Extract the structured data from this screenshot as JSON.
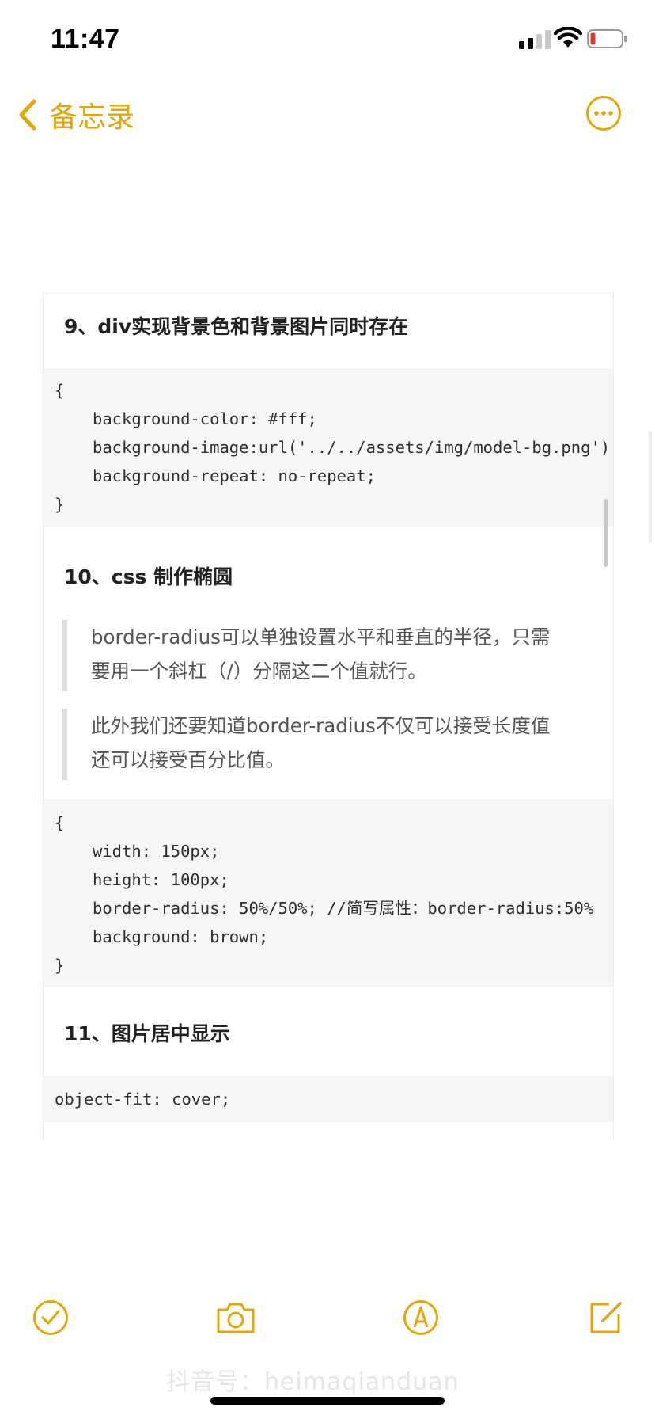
{
  "status_bar": {
    "time": "11:47"
  },
  "nav": {
    "back_label": "备忘录"
  },
  "sections": {
    "s9_heading": "9、div实现背景色和背景图片同时存在",
    "s9_code": [
      "{",
      "background-color: #fff;",
      "background-image:url('../../assets/img/model-bg.png')",
      "background-repeat: no-repeat;",
      "}"
    ],
    "s10_heading": "10、css 制作椭圆",
    "s10_quote1": "border-radius可以单独设置水平和垂直的半径，只需要用一个斜杠（/）分隔这二个值就行。",
    "s10_quote2": "此外我们还要知道border-radius不仅可以接受长度值还可以接受百分比值。",
    "s10_code": [
      "{",
      "width: 150px;",
      "height: 100px;",
      "border-radius: 50%/50%; //简写属性：border-radius:50%",
      "background: brown;",
      "}"
    ],
    "s11_heading": "11、图片居中显示",
    "s11_code": "object-fit: cover;"
  },
  "toolbar": {
    "checklist_icon": "checkmark-circle-icon",
    "camera_icon": "camera-icon",
    "markup_icon": "pen-tip-icon",
    "compose_icon": "compose-icon"
  },
  "watermark": "抖音号：heimaqianduan",
  "colors": {
    "accent": "#e3a60b",
    "code_bg": "#f6f6f6",
    "quote_bar": "#dcdcdc"
  }
}
